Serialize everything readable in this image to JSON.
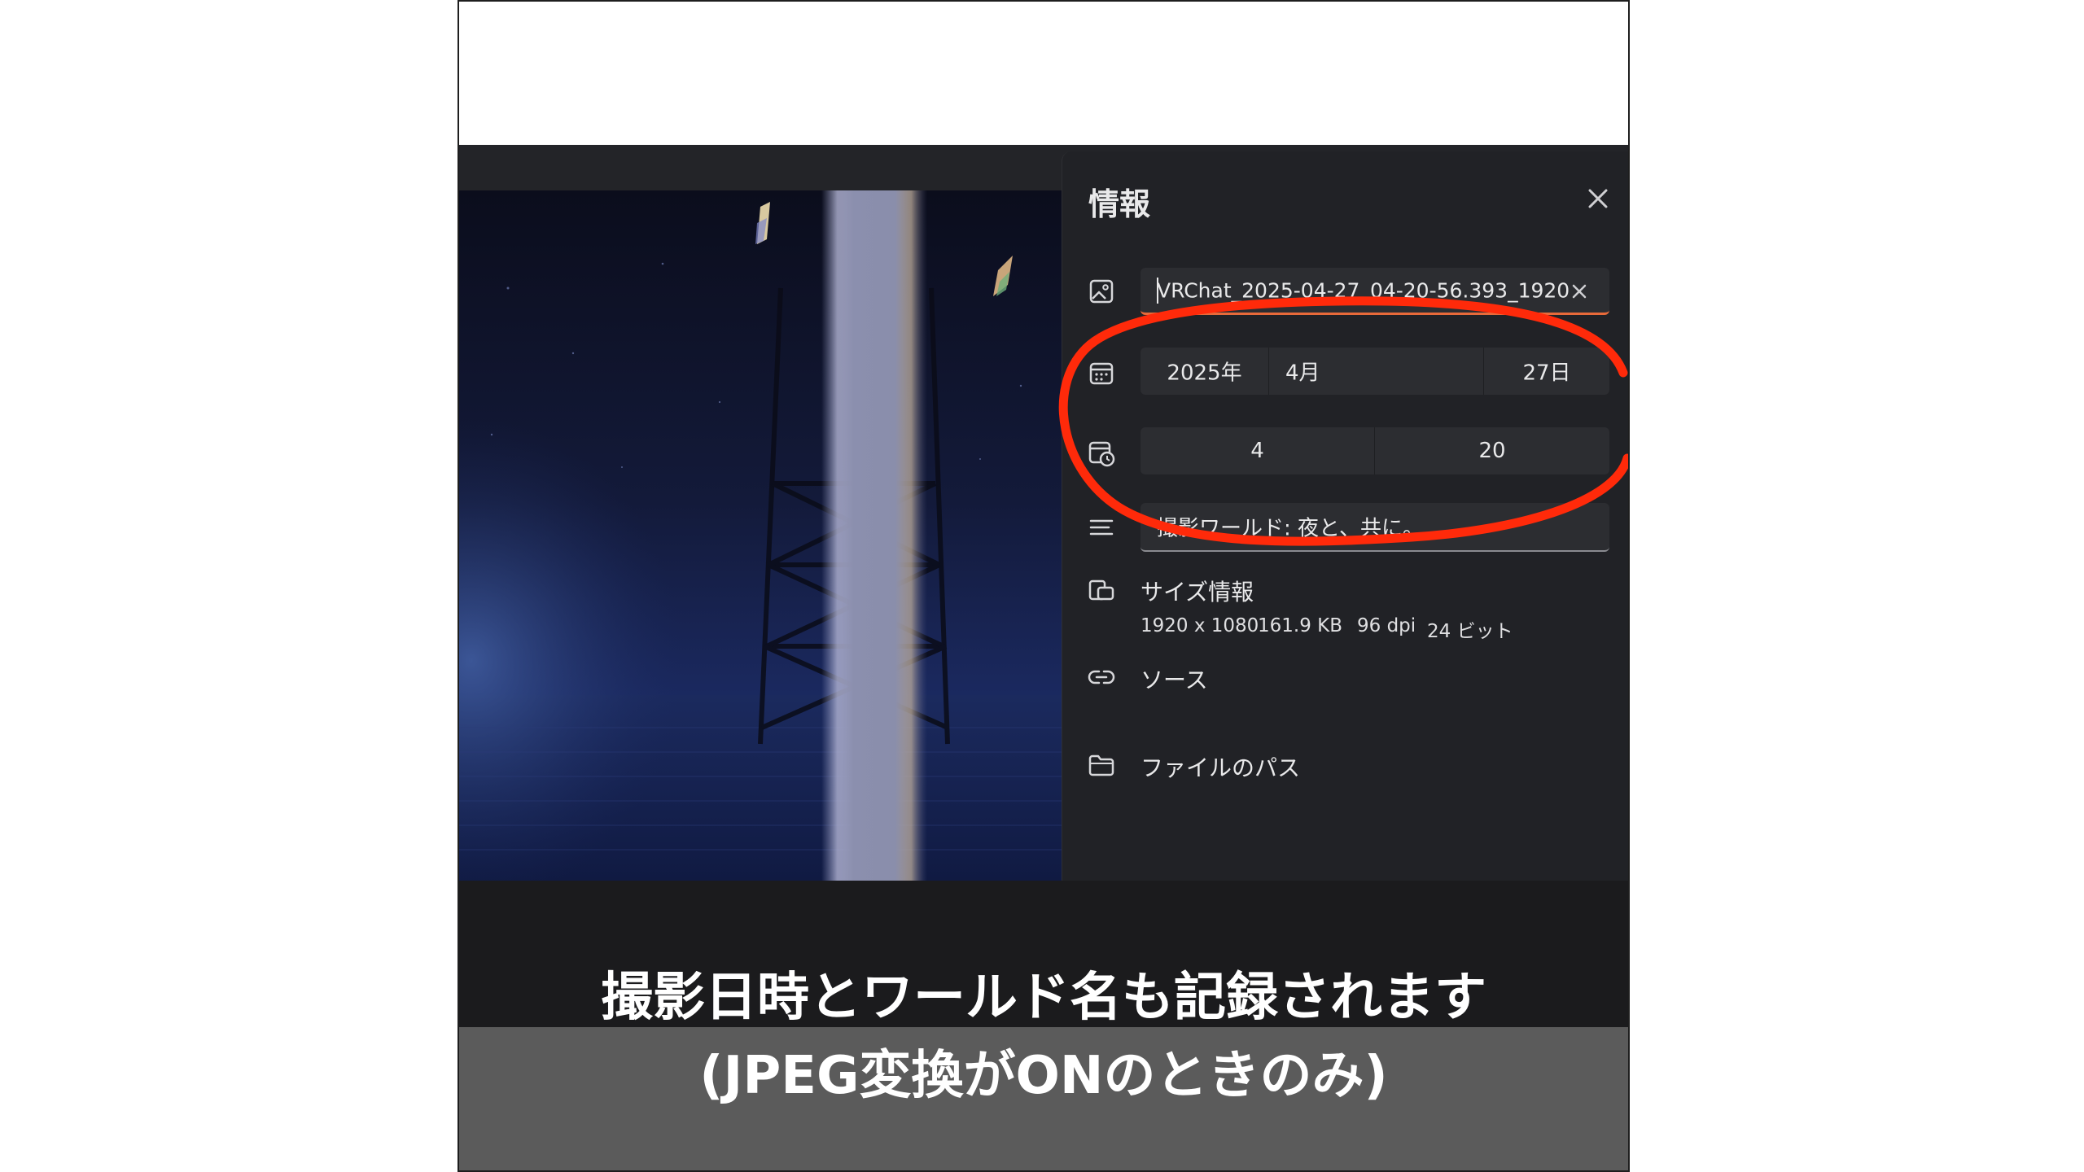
{
  "panel": {
    "title": "情報",
    "file_name": "VRChat_2025-04-27_04-20-56.393_1920",
    "date": {
      "year": "2025年",
      "month": "4月",
      "day": "27日"
    },
    "time": {
      "hour": "4",
      "minute": "20"
    },
    "description": "撮影ワールド: 夜と、共に。",
    "size_info": {
      "label": "サイズ情報",
      "resolution": "1920 x 1080",
      "file_size": "161.9 KB",
      "dpi": "96 dpi",
      "bit_depth": "24 ビット"
    },
    "source_label": "ソース",
    "file_path_label": "ファイルのパス"
  },
  "caption": {
    "line1": "撮影日時とワールド名も記録されます",
    "line2": "(JPEG変換がONのときのみ)"
  },
  "icons": [
    "image-icon",
    "calendar-icon",
    "clock-calendar-icon",
    "text-lines-icon",
    "size-icon",
    "link-icon",
    "folder-icon",
    "close-icon",
    "clear-icon"
  ],
  "colors": {
    "panel_bg": "#212226",
    "field_bg": "#2c2d31",
    "accent_underline": "#e86a3a",
    "annotation_red": "#ff2a0a",
    "caption_band": "#5b5b5b"
  }
}
